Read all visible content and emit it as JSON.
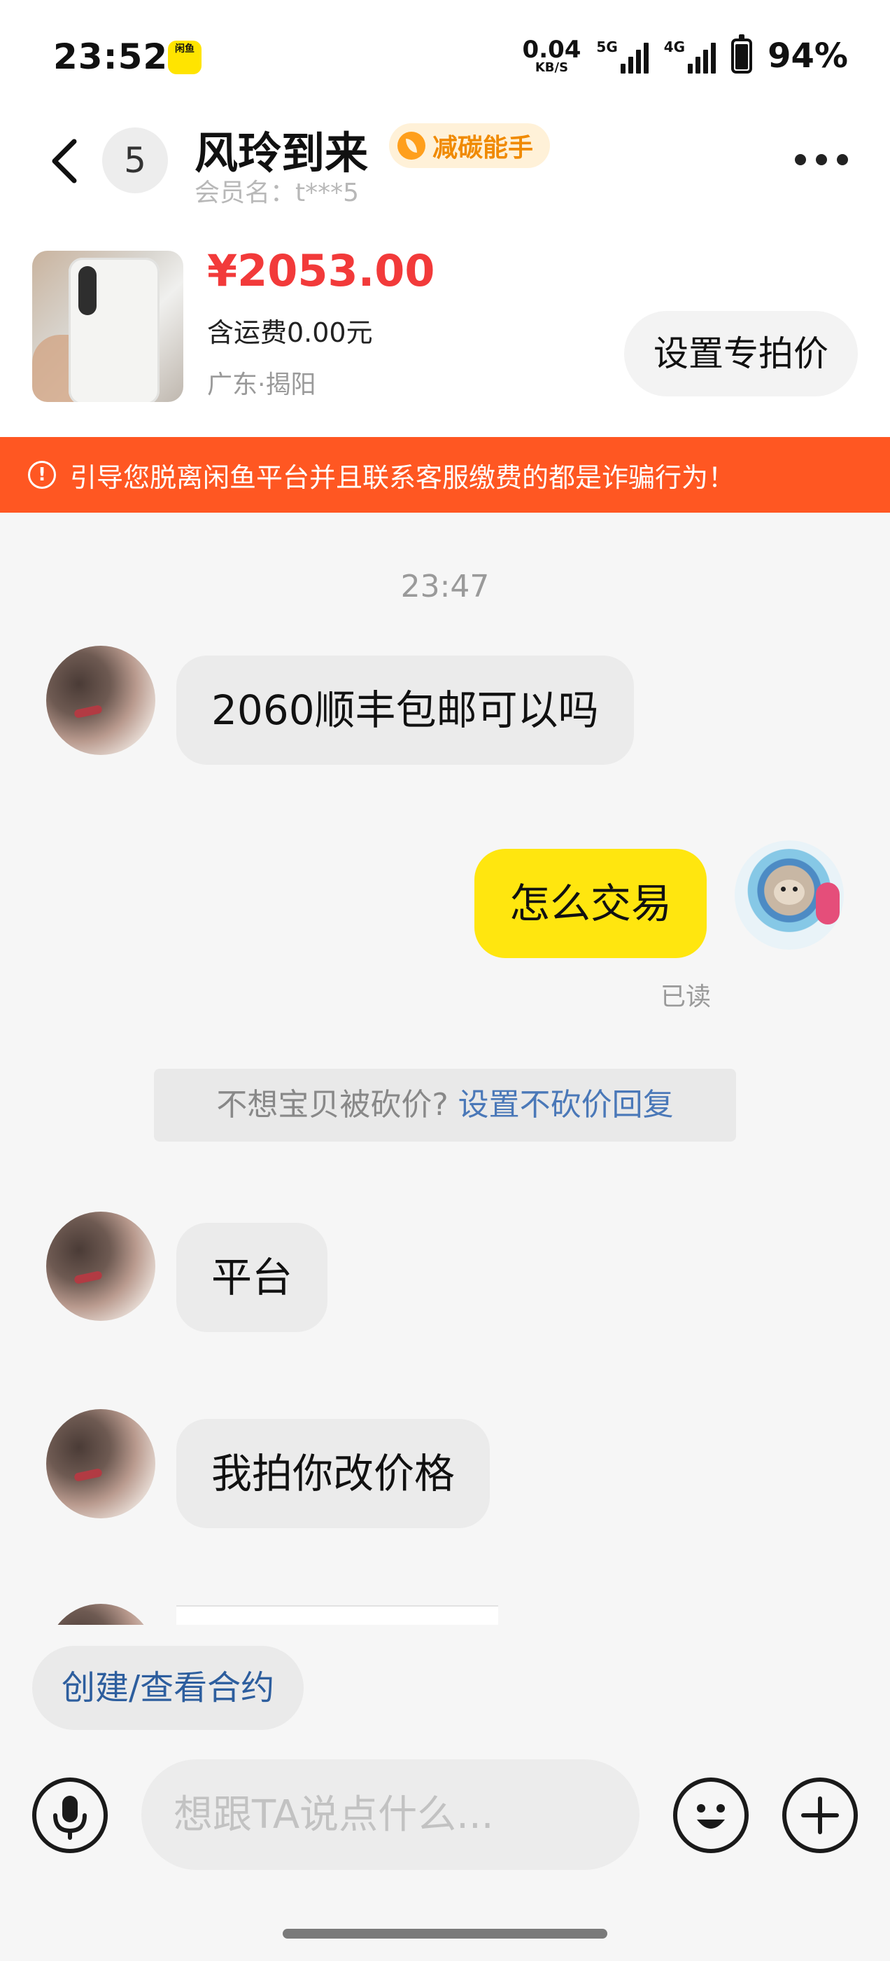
{
  "status_bar": {
    "time": "23:52",
    "app_icon_label": "闲鱼",
    "net_speed": "0.04",
    "net_speed_unit": "KB/S",
    "network1": "5G",
    "network2": "4G",
    "battery": "94%",
    "battery_level": 0.94
  },
  "header": {
    "unread_count": "5",
    "peer_name": "风玲到来",
    "badge": "减碳能手",
    "member_name": "会员名：t***5"
  },
  "product": {
    "price": "¥2053.00",
    "shipping": "含运费0.00元",
    "location": "广东·揭阳",
    "set_price_button": "设置专拍价"
  },
  "warning": {
    "text": "引导您脱离闲鱼平台并且联系客服缴费的都是诈骗行为！"
  },
  "chat": {
    "timestamp": "23:47",
    "messages": [
      {
        "from": "peer",
        "text": "2060顺丰包邮可以吗"
      },
      {
        "from": "me",
        "text": "怎么交易"
      },
      {
        "from": "peer",
        "text": "平台"
      },
      {
        "from": "peer",
        "text": "我拍你改价格"
      }
    ],
    "read_status": "已读",
    "hint_text": "不想宝贝被砍价? ",
    "hint_link": "设置不砍价回复"
  },
  "bottom": {
    "contract_button": "创建/查看合约",
    "input_placeholder": "想跟TA说点什么...",
    "input_value": ""
  },
  "colors": {
    "accent_yellow": "#FFE60F",
    "price_red": "#F23A3A",
    "warning_orange": "#FF5722",
    "link_blue": "#4A78B8"
  },
  "icons": [
    "back-arrow-icon",
    "more-icon",
    "leaf-icon",
    "alert-icon",
    "microphone-icon",
    "emoji-icon",
    "plus-icon"
  ]
}
